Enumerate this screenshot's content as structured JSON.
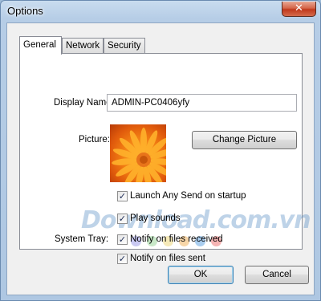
{
  "window": {
    "title": "Options",
    "close_glyph": "✕"
  },
  "tabs": [
    {
      "label": "General",
      "active": true
    },
    {
      "label": "Network",
      "active": false
    },
    {
      "label": "Security",
      "active": false
    }
  ],
  "general": {
    "display_name_label": "Display Name:",
    "display_name_value": "ADMIN-PC0406yfy",
    "picture_label": "Picture:",
    "change_picture_label": "Change Picture",
    "system_tray_label": "System Tray:",
    "options": [
      {
        "label": "Launch Any Send on startup",
        "checked": true
      },
      {
        "label": "Play sounds",
        "checked": true
      },
      {
        "label": "Notify on files received",
        "checked": true
      },
      {
        "label": "Notify on files sent",
        "checked": true
      }
    ]
  },
  "buttons": {
    "ok": "OK",
    "cancel": "Cancel"
  },
  "watermark": {
    "text": "Download.com.vn"
  },
  "icons": {
    "close": "close-icon",
    "check": "checkmark-icon"
  },
  "colors": {
    "titlebar": "#b6cde6",
    "close": "#c0391c"
  }
}
